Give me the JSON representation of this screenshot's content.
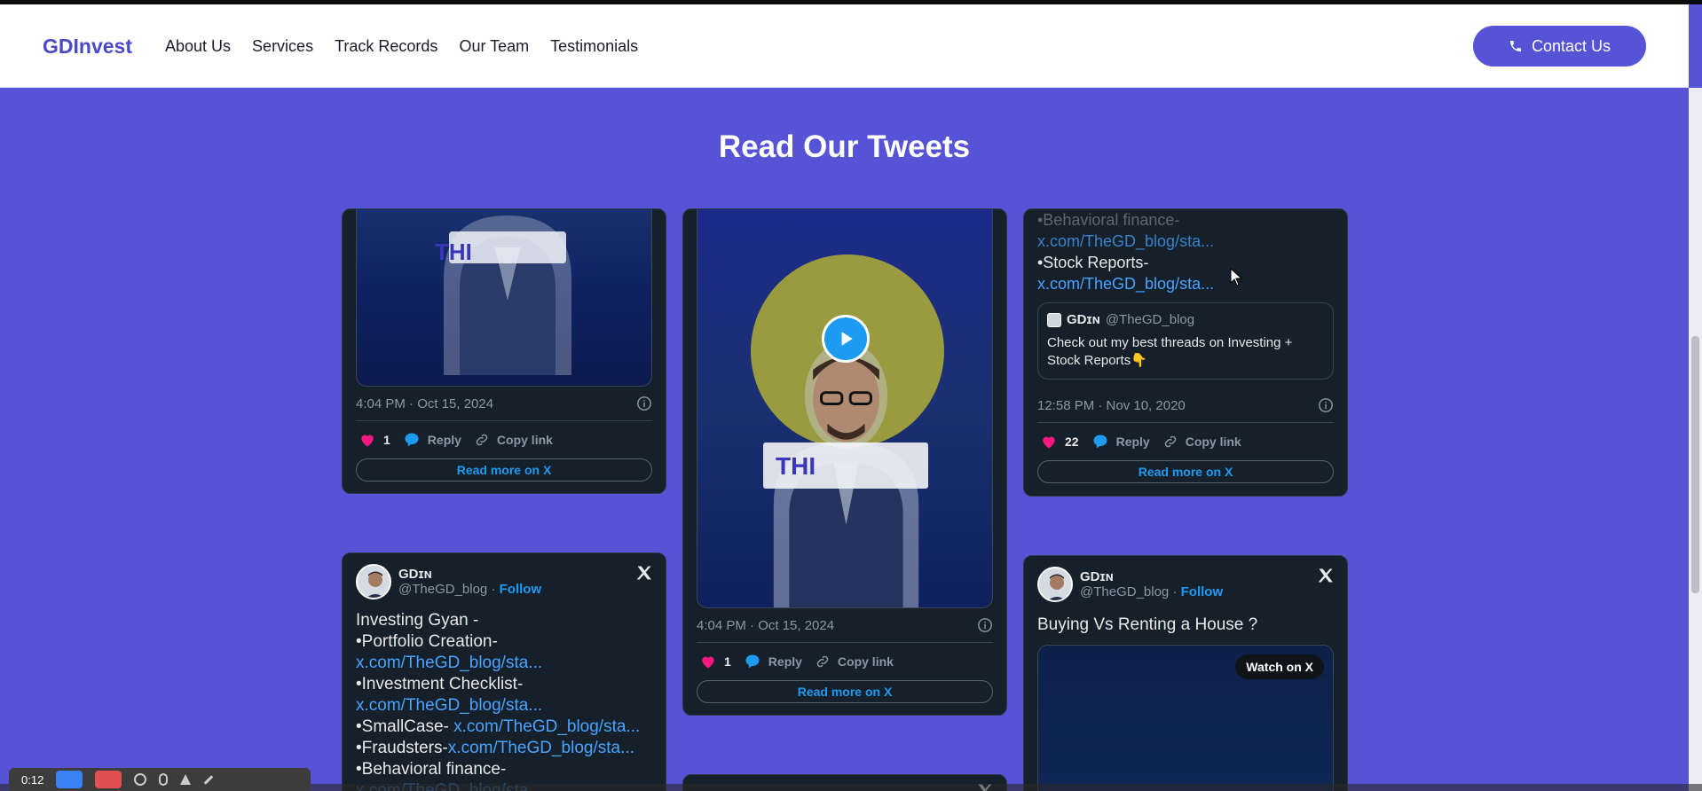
{
  "header": {
    "logo": "GDInvest",
    "nav": [
      "About Us",
      "Services",
      "Track Records",
      "Our Team",
      "Testimonials"
    ],
    "contact_label": "Contact Us"
  },
  "section": {
    "title": "Read Our Tweets"
  },
  "tweets": {
    "t1": {
      "timestamp": "4:04 PM · Oct 15, 2024",
      "likes": "1",
      "reply": "Reply",
      "copy": "Copy link",
      "readmore": "Read more on X",
      "media_text": "THI"
    },
    "t2": {
      "timestamp": "4:04 PM · Oct 15, 2024",
      "likes": "1",
      "reply": "Reply",
      "copy": "Copy link",
      "readmore": "Read more on X",
      "media_text": "THI"
    },
    "t3": {
      "lines": [
        {
          "text": "•Behavioral finance-",
          "link": ""
        },
        {
          "text": "",
          "link": "x.com/TheGD_blog/sta..."
        },
        {
          "text": "•Stock Reports-",
          "link": ""
        },
        {
          "text": "",
          "link": "x.com/TheGD_blog/sta..."
        }
      ],
      "quote_name": "GDɪɴ",
      "quote_handle": "@TheGD_blog",
      "quote_text": "Check out my best threads on Investing + Stock Reports👇",
      "timestamp": "12:58 PM · Nov 10, 2020",
      "likes": "22",
      "reply": "Reply",
      "copy": "Copy link",
      "readmore": "Read more on X"
    },
    "t4": {
      "name": "GDɪɴ",
      "handle": "@TheGD_blog",
      "dot": "·",
      "follow": "Follow",
      "lines": [
        {
          "text": "Investing Gyan -",
          "link": ""
        },
        {
          "text": "•Portfolio Creation-",
          "link": ""
        },
        {
          "text": "",
          "link": "x.com/TheGD_blog/sta..."
        },
        {
          "text": "•Investment Checklist-",
          "link": ""
        },
        {
          "text": "",
          "link": "x.com/TheGD_blog/sta..."
        },
        {
          "text": "•SmallCase- ",
          "link": "x.com/TheGD_blog/sta..."
        },
        {
          "text": "•Fraudsters-",
          "link": "x.com/TheGD_blog/sta..."
        },
        {
          "text": "•Behavioral finance-",
          "link": ""
        },
        {
          "text": "",
          "link": "x.com/TheGD_blog/sta..."
        }
      ]
    },
    "t5": {
      "name": "GDɪɴ",
      "handle": "@TheGD_blog",
      "dot": "·",
      "follow": "Follow",
      "text": "Buying Vs Renting a House ?",
      "watch": "Watch on X"
    }
  },
  "recorder": {
    "time": "0:12"
  },
  "colors": {
    "accent": "#5653d6",
    "tweet_bg": "#15202b",
    "link": "#1d9bf0",
    "like": "#f91880"
  }
}
